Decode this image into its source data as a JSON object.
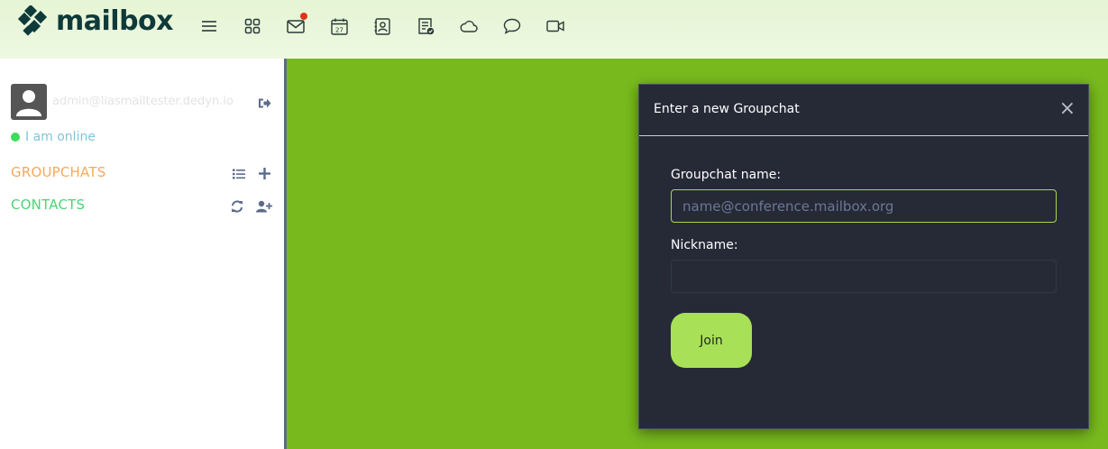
{
  "app": {
    "logo_text": "mailbox"
  },
  "topbar": {
    "icons": [
      {
        "name": "menu-icon"
      },
      {
        "name": "apps-grid-icon"
      },
      {
        "name": "mail-icon",
        "badge": true
      },
      {
        "name": "calendar-icon",
        "day": "27"
      },
      {
        "name": "contacts-icon"
      },
      {
        "name": "tasks-icon"
      },
      {
        "name": "cloud-icon"
      },
      {
        "name": "chat-icon"
      },
      {
        "name": "video-icon"
      }
    ]
  },
  "sidebar": {
    "user_email": "admin@liasmailtester.dedyn.io",
    "status_text": "I am online",
    "groupchats_label": "GROUPCHATS",
    "contacts_label": "CONTACTS"
  },
  "modal": {
    "title": "Enter a new Groupchat",
    "close_label": "×",
    "groupchat_name_label": "Groupchat name:",
    "groupchat_name_placeholder": "name@conference.mailbox.org",
    "groupchat_name_value": "",
    "nickname_label": "Nickname:",
    "nickname_value": "",
    "join_label": "Join"
  },
  "colors": {
    "background": "#78ba1e",
    "modal_bg": "#262a36",
    "accent_green": "#a8e157",
    "groupchats": "#f5a85a",
    "contacts": "#4bd474",
    "online": "#3ddc5a",
    "badge": "#e0341a"
  }
}
